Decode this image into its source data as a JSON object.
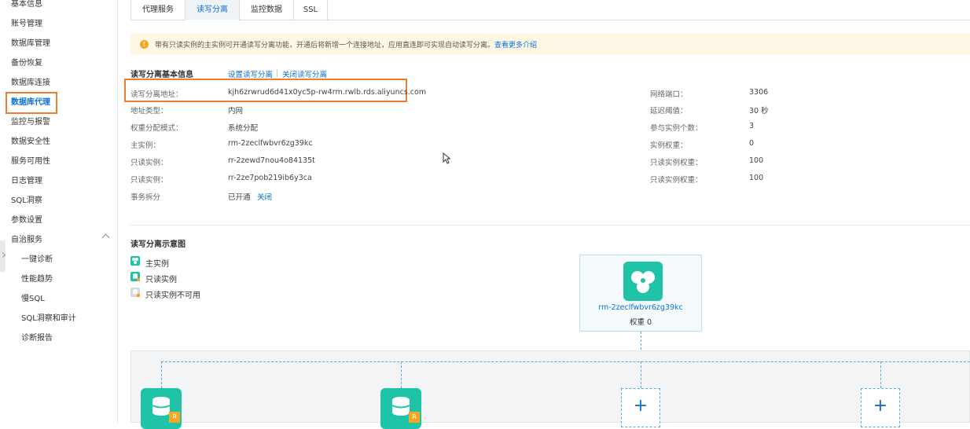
{
  "sidebar": {
    "items": [
      {
        "label": "基本信息"
      },
      {
        "label": "账号管理"
      },
      {
        "label": "数据库管理"
      },
      {
        "label": "备份恢复"
      },
      {
        "label": "数据库连接"
      },
      {
        "label": "数据库代理"
      },
      {
        "label": "监控与报警"
      },
      {
        "label": "数据安全性"
      },
      {
        "label": "服务可用性"
      },
      {
        "label": "日志管理"
      },
      {
        "label": "SQL洞察"
      },
      {
        "label": "参数设置"
      },
      {
        "label": "自治服务"
      }
    ],
    "subitems": [
      {
        "label": "一键诊断"
      },
      {
        "label": "性能趋势"
      },
      {
        "label": "慢SQL"
      },
      {
        "label": "SQL洞察和审计"
      },
      {
        "label": "诊断报告"
      }
    ],
    "active_index": 5
  },
  "tabs": [
    {
      "label": "代理服务"
    },
    {
      "label": "读写分离"
    },
    {
      "label": "监控数据"
    },
    {
      "label": "SSL"
    }
  ],
  "notice": {
    "text": "带有只读实例的主实例可开通读写分离功能，开通后将新增一个连接地址，应用直连即可实现自动读写分离。",
    "link": "查看更多介绍",
    "icon": "info-icon",
    "color": "#f5a623"
  },
  "basic": {
    "title": "读写分离基本信息",
    "set_link": "设置读写分离",
    "close_link": "关闭读写分离",
    "left": [
      {
        "label": "读写分离地址：",
        "value": "kjh6zrwrud6d41x0yc5p-rw4rm.rwlb.rds.aliyuncs.com"
      },
      {
        "label": "地址类型：",
        "value": "内网"
      },
      {
        "label": "权重分配模式：",
        "value": "系统分配"
      },
      {
        "label": "主实例：",
        "value": "rm-2zeclfwbvr6zg39kc"
      },
      {
        "label": "只读实例：",
        "value": "rr-2zewd7nou4o84135t"
      },
      {
        "label": "只读实例：",
        "value": "rr-2ze7pob219ib6y3ca"
      },
      {
        "label": "事务拆分",
        "value": "已开通",
        "action": "关闭"
      }
    ],
    "right": [
      {
        "label": "网络端口：",
        "value": "3306"
      },
      {
        "label": "延迟阈值：",
        "value": "30 秒"
      },
      {
        "label": "参与实例个数：",
        "value": "3"
      },
      {
        "label": "实例权重：",
        "value": "0"
      },
      {
        "label": "只读实例权重：",
        "value": "100"
      },
      {
        "label": "只读实例权重：",
        "value": "100"
      }
    ]
  },
  "diagram": {
    "title": "读写分离示意图",
    "legend": [
      {
        "label": "主实例",
        "icon": "master-instance-icon",
        "color": "#1fc4a8"
      },
      {
        "label": "只读实例",
        "icon": "readonly-instance-icon",
        "color": "#1fc4a8"
      },
      {
        "label": "只读实例不可用",
        "icon": "readonly-unavailable-icon",
        "color": "#d9d9d9"
      }
    ],
    "master": {
      "name": "rm-2zeclfwbvr6zg39kc",
      "weight": "权重 0"
    },
    "readonly_badge": "R",
    "add_symbol": "+"
  },
  "colors": {
    "accent": "#0b70d6",
    "highlight_box": "#ed7d31",
    "instance": "#1fc4a8"
  }
}
